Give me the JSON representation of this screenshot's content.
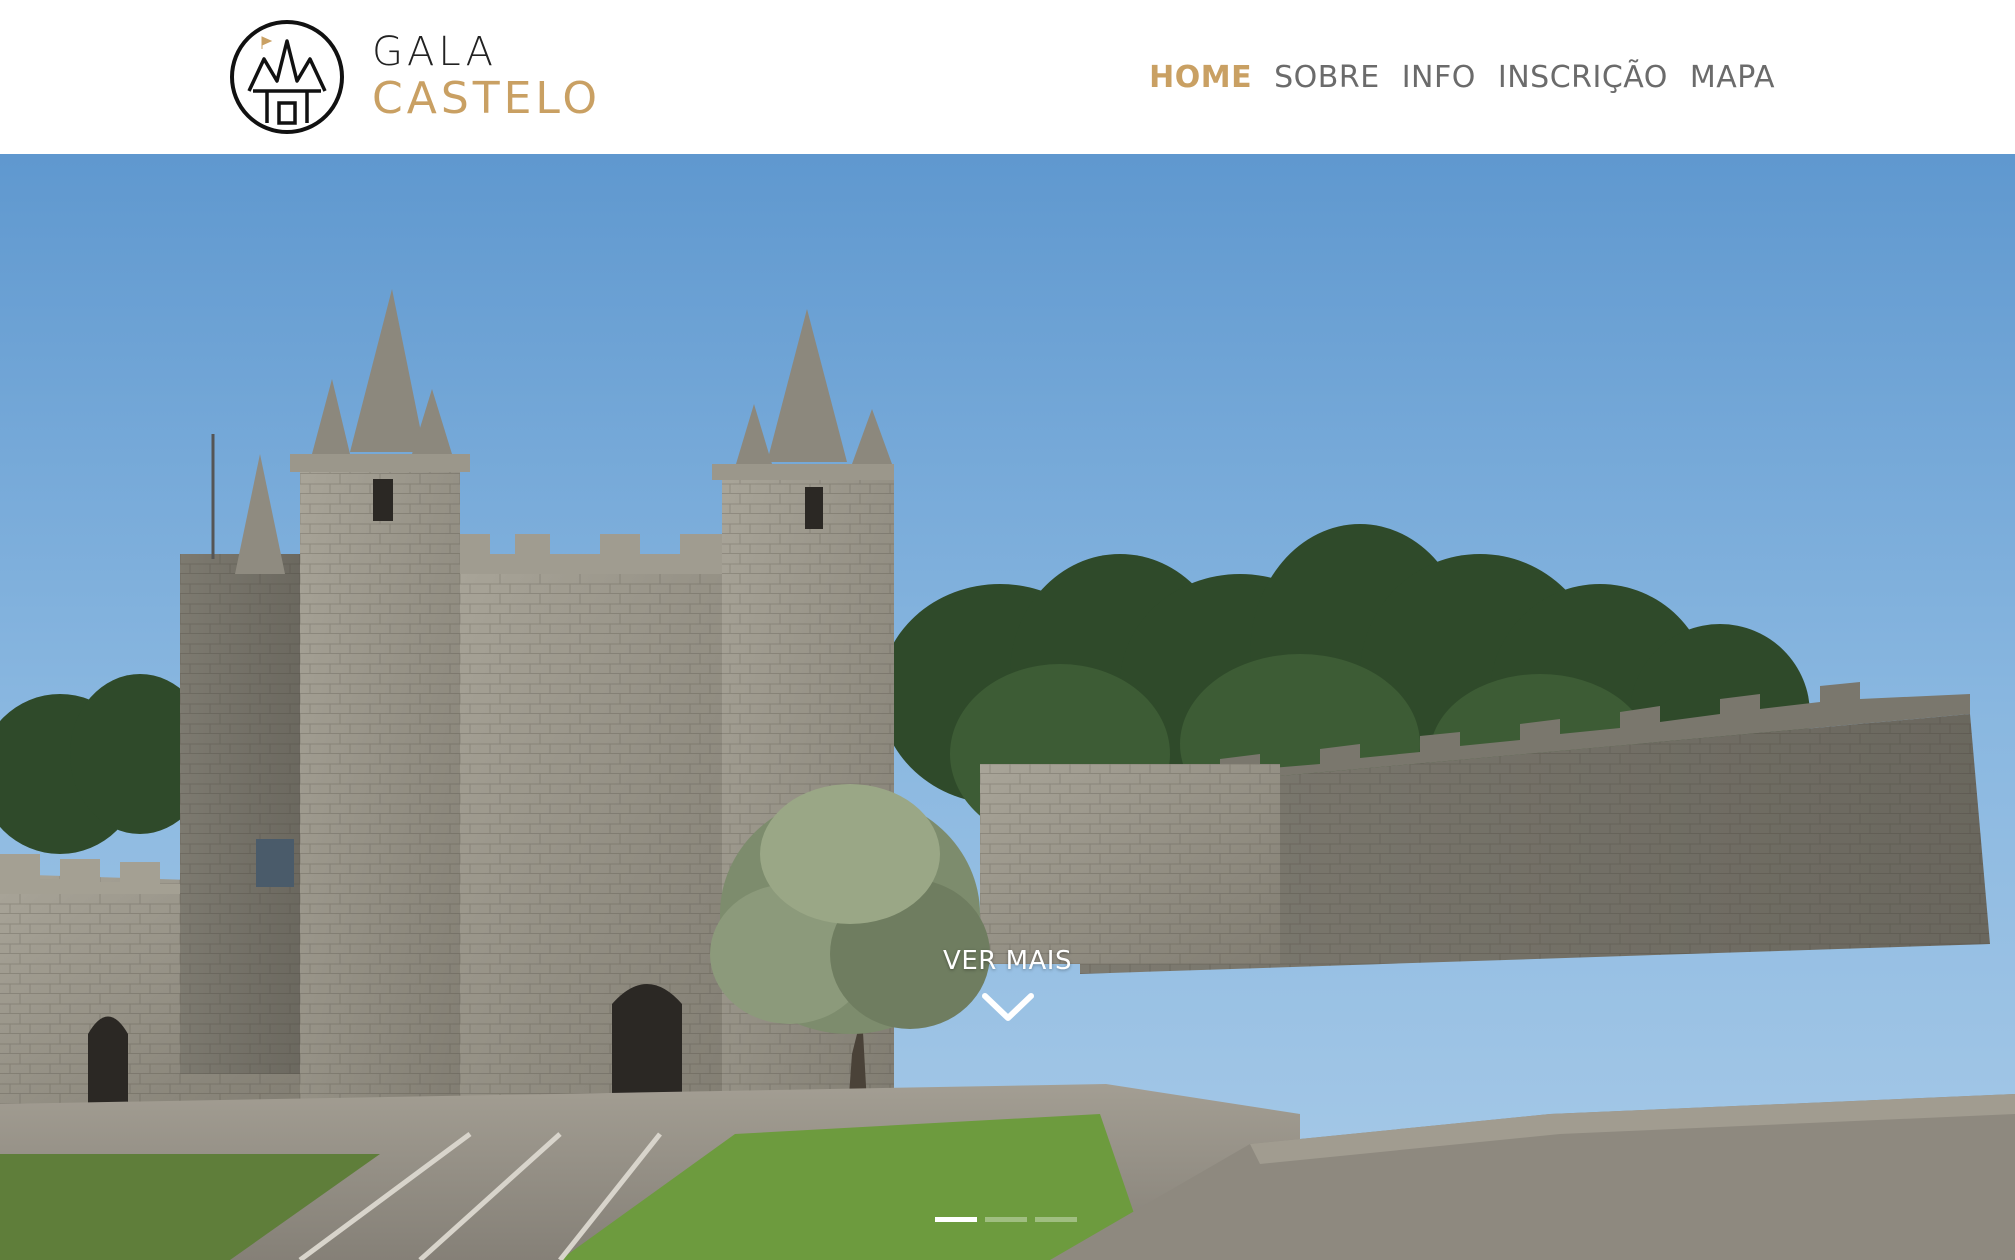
{
  "brand": {
    "line1": "GALA",
    "line2": "CASTELO",
    "logo_icon": "castle-logo-icon",
    "accent_color": "#c9a063",
    "dark_color": "#222222"
  },
  "nav": {
    "items": [
      {
        "label": "HOME",
        "active": true
      },
      {
        "label": "SOBRE",
        "active": false
      },
      {
        "label": "INFO",
        "active": false
      },
      {
        "label": "INSCRIÇÃO",
        "active": false
      },
      {
        "label": "MAPA",
        "active": false
      }
    ],
    "active_color": "#c9a063",
    "inactive_color": "#6b6b6b"
  },
  "hero": {
    "image": "castle-photo",
    "cta_label": "VER MAIS",
    "cta_icon": "chevron-down-icon",
    "slides": [
      {
        "active": true
      },
      {
        "active": false
      },
      {
        "active": false
      }
    ]
  }
}
